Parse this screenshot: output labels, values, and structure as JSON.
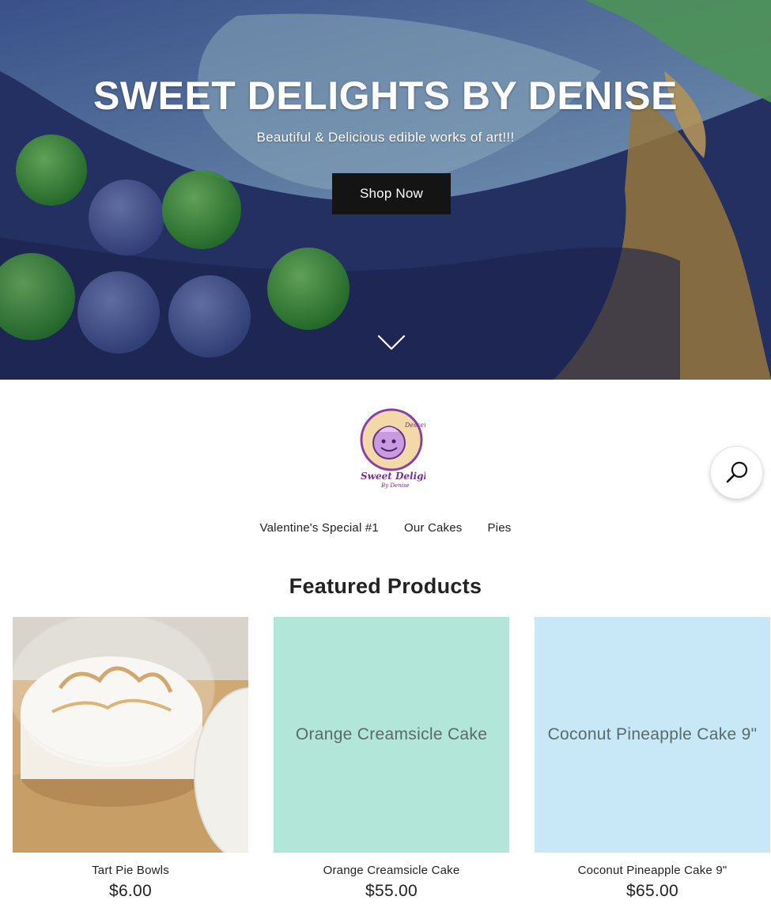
{
  "hero": {
    "title": "SWEET DELIGHTS BY DENISE",
    "subtitle": "Beautiful & Delicious edible works of art!!!",
    "button_label": "Shop Now"
  },
  "header": {
    "logo_alt": "Sweet Delights By Denise",
    "search_icon": "search-icon"
  },
  "nav": {
    "items": [
      {
        "label": "Valentine's Special #1"
      },
      {
        "label": "Our Cakes"
      },
      {
        "label": "Pies"
      }
    ]
  },
  "featured": {
    "title": "Featured Products",
    "products": [
      {
        "name": "Tart Pie Bowls",
        "price": "$6.00",
        "thumb_text": "",
        "thumb_color": "#c9a77c"
      },
      {
        "name": "Orange Creamsicle Cake",
        "price": "$55.00",
        "thumb_text": "Orange Creamsicle Cake",
        "thumb_color": "#b2e6d8"
      },
      {
        "name": "Coconut Pineapple Cake 9\"",
        "price": "$65.00",
        "thumb_text": "Coconut Pineapple Cake 9\"",
        "thumb_color": "#c8e8f8"
      }
    ]
  },
  "colors": {
    "button_bg": "#141414",
    "text": "#222222"
  }
}
